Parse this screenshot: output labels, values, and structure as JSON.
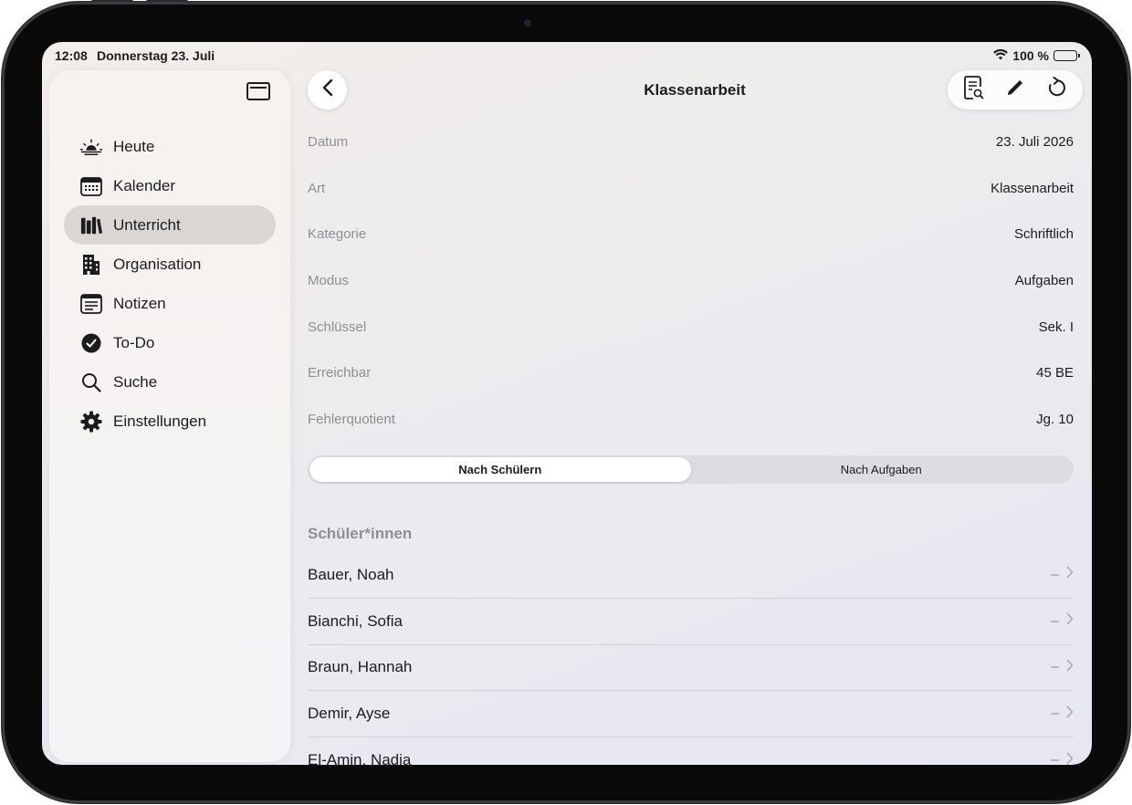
{
  "status_bar": {
    "time": "12:08",
    "date": "Donnerstag 23. Juli",
    "battery": "100 %"
  },
  "sidebar": {
    "items": [
      {
        "label": "Heute",
        "icon": "sunrise-icon"
      },
      {
        "label": "Kalender",
        "icon": "calendar-icon"
      },
      {
        "label": "Unterricht",
        "icon": "books-icon",
        "active": true
      },
      {
        "label": "Organisation",
        "icon": "building-icon"
      },
      {
        "label": "Notizen",
        "icon": "note-icon"
      },
      {
        "label": "To-Do",
        "icon": "checkmark-circle-icon"
      },
      {
        "label": "Suche",
        "icon": "search-icon"
      },
      {
        "label": "Einstellungen",
        "icon": "gear-icon"
      }
    ]
  },
  "header": {
    "title": "Klassenarbeit"
  },
  "details": [
    {
      "key": "Datum",
      "value": "23. Juli 2026"
    },
    {
      "key": "Art",
      "value": "Klassenarbeit"
    },
    {
      "key": "Kategorie",
      "value": "Schriftlich"
    },
    {
      "key": "Modus",
      "value": "Aufgaben"
    },
    {
      "key": "Schlüssel",
      "value": "Sek. I"
    },
    {
      "key": "Erreichbar",
      "value": "45 BE"
    },
    {
      "key": "Fehlerquotient",
      "value": "Jg. 10"
    }
  ],
  "segments": [
    {
      "label": "Nach Schülern",
      "active": true
    },
    {
      "label": "Nach Aufgaben",
      "active": false
    }
  ],
  "students_section": {
    "header": "Schüler*innen"
  },
  "students": [
    {
      "name": "Bauer, Noah",
      "value": "–"
    },
    {
      "name": "Bianchi, Sofia",
      "value": "–"
    },
    {
      "name": "Braun, Hannah",
      "value": "–"
    },
    {
      "name": "Demir, Ayse",
      "value": "–"
    },
    {
      "name": "El-Amin, Nadia",
      "value": "–"
    }
  ]
}
